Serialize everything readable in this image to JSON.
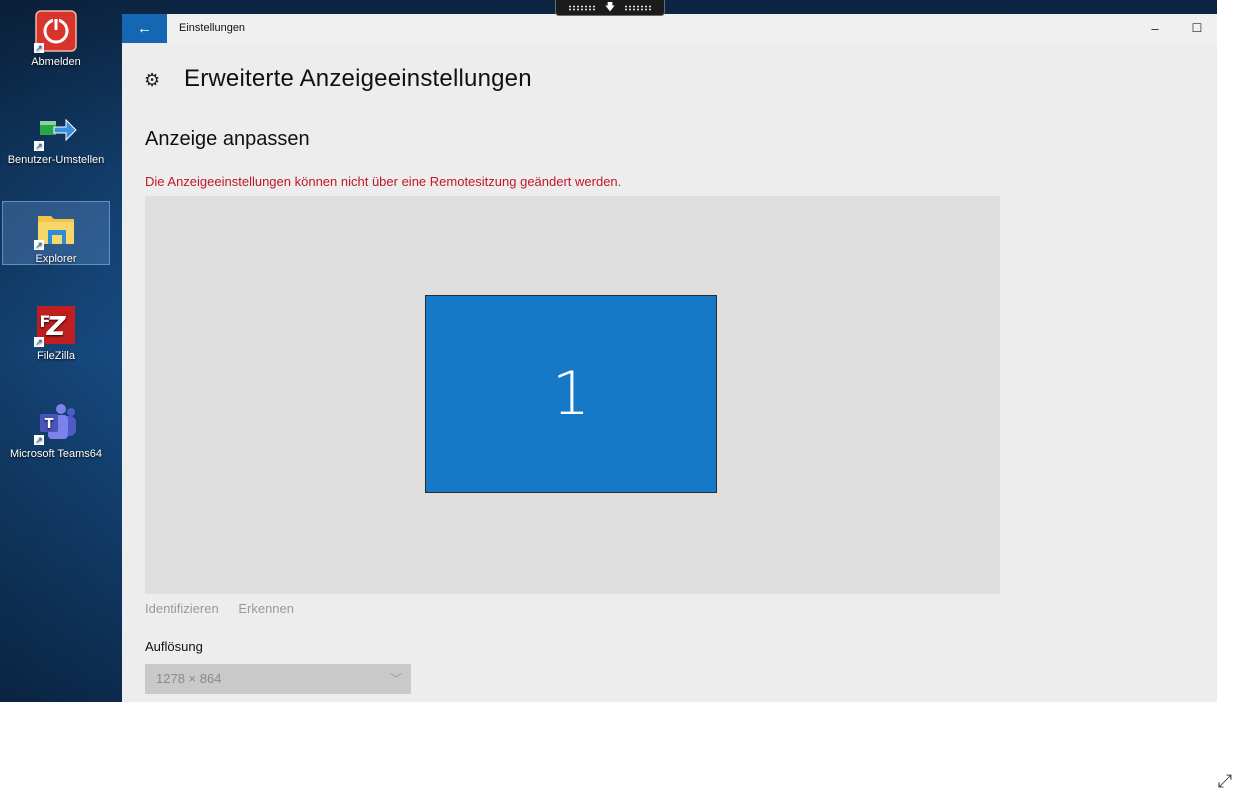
{
  "desktop": {
    "icons": [
      {
        "label": "Abmelden",
        "icon": "logoff-icon"
      },
      {
        "label": "Benutzer-Umstellen",
        "icon": "switch-user-icon"
      },
      {
        "label": "Explorer",
        "icon": "folder-icon"
      },
      {
        "label": "FileZilla",
        "icon": "filezilla-icon"
      },
      {
        "label": "Microsoft Teams64",
        "icon": "teams-icon"
      }
    ]
  },
  "window": {
    "title": "Einstellungen",
    "back_icon": "←",
    "minimize": "–",
    "maximize": "☐"
  },
  "page": {
    "gear_icon": "⚙",
    "title": "Erweiterte Anzeigeeinstellungen",
    "section_title": "Anzeige anpassen",
    "warning": "Die Anzeigeeinstellungen können nicht über eine Remotesitzung geändert werden.",
    "monitor_number": "1",
    "identify": "Identifizieren",
    "detect": "Erkennen",
    "resolution_label": "Auflösung",
    "resolution_value": "1278 × 864",
    "chevron": "﹀"
  },
  "colors": {
    "accent": "#1567b3",
    "monitor": "#1579c8",
    "warning": "#c0172b"
  },
  "viewer": {
    "resize_icon": "⤢"
  }
}
